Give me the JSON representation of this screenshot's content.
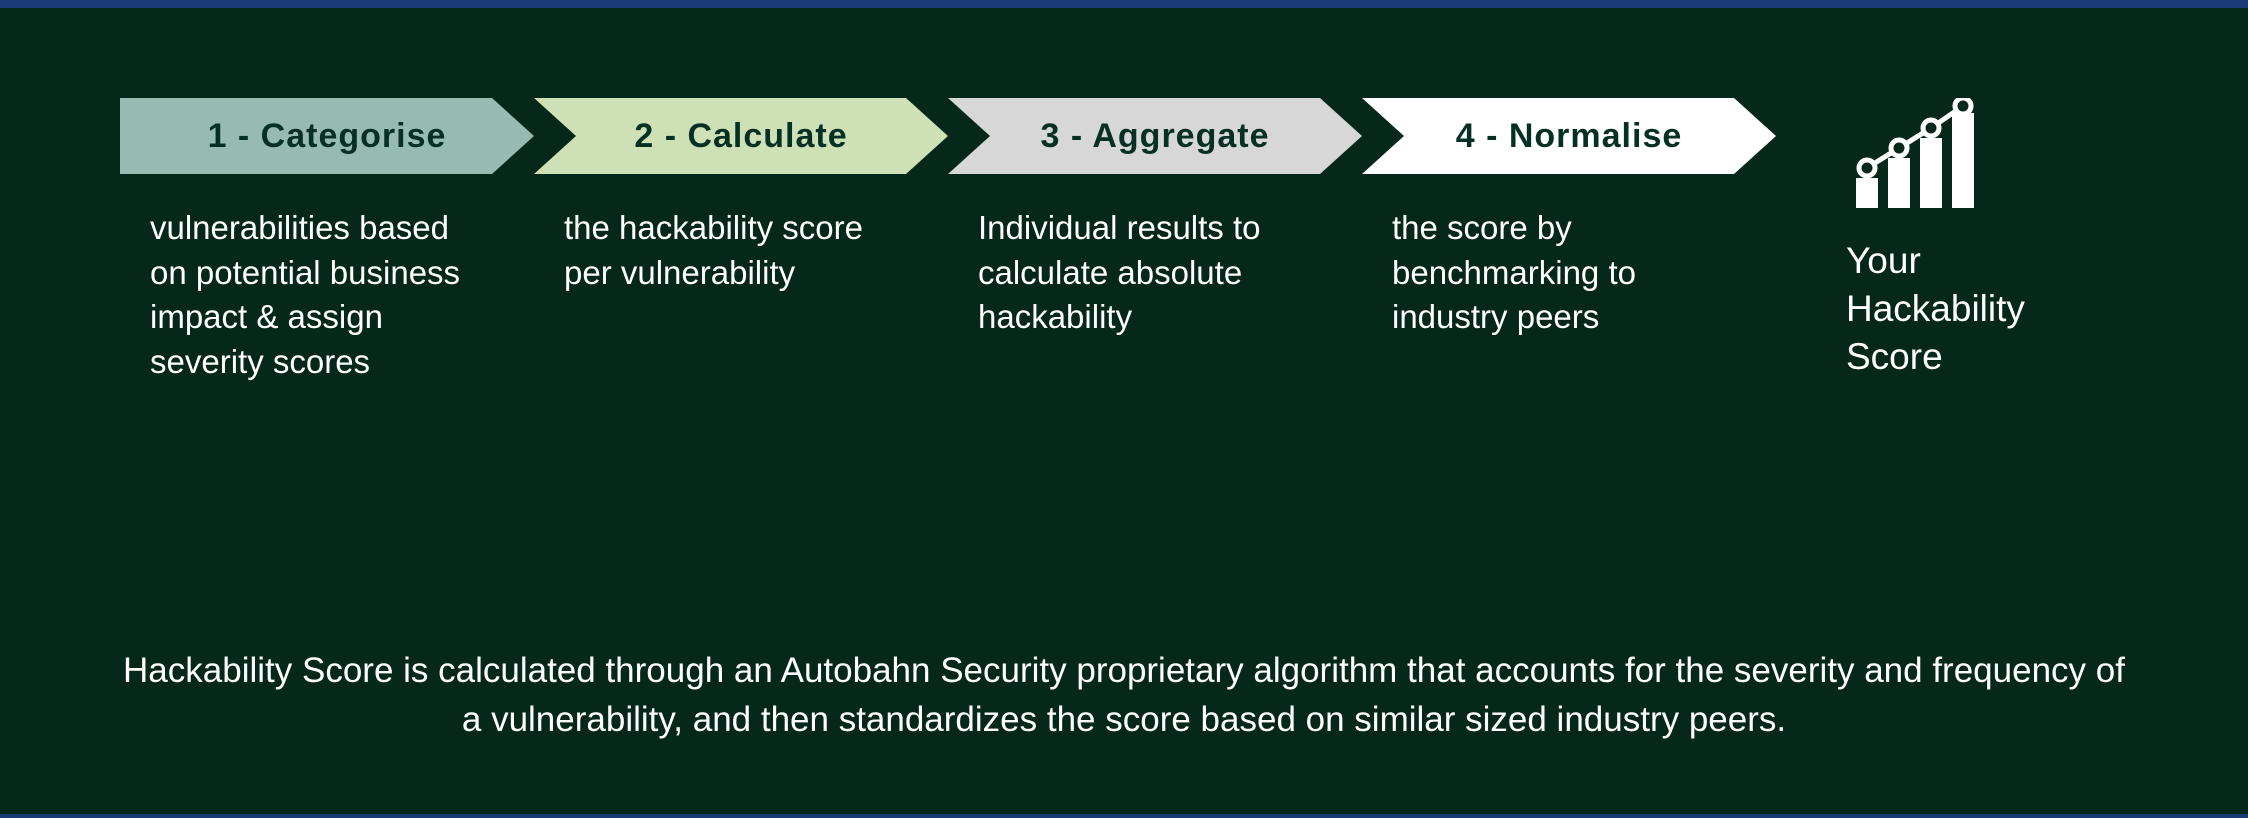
{
  "steps": [
    {
      "label": "1 - Categorise",
      "description": "vulnerabilities based on potential business impact & assign severity scores",
      "color": "#97bbb0"
    },
    {
      "label": "2 - Calculate",
      "description": "the hackability score per vulnerability",
      "color": "#cde0b6"
    },
    {
      "label": "3 - Aggregate",
      "description": "Individual results to calculate absolute hackability",
      "color": "#d6d7d6"
    },
    {
      "label": "4 - Normalise",
      "description": "the score by benchmarking to industry peers",
      "color": "#ffffff"
    }
  ],
  "result": {
    "label": "Your Hackability Score"
  },
  "footer": "Hackability Score is calculated through an Autobahn Security proprietary algorithm that accounts for the severity and frequency of a vulnerability, and then standardizes the score based on similar sized industry peers."
}
